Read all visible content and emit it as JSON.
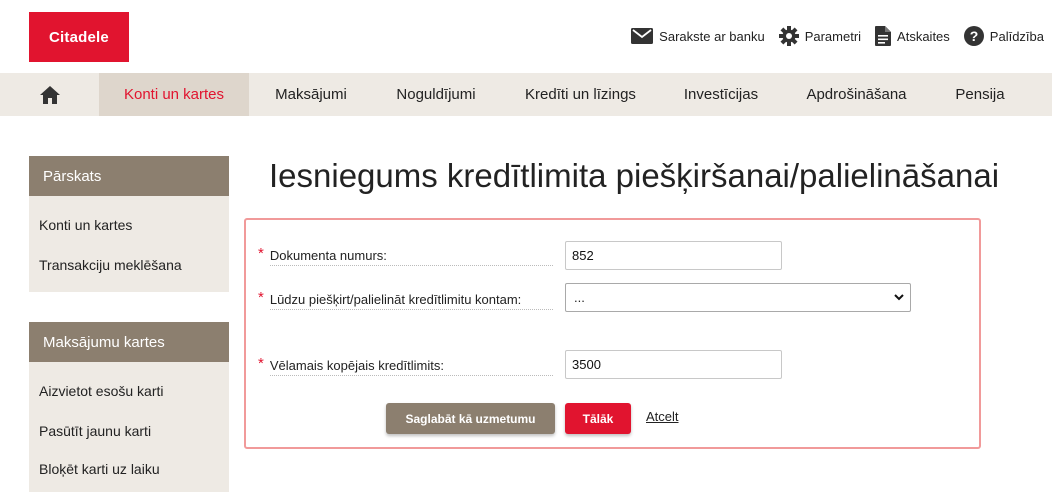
{
  "brand": {
    "logo_text": "Citadele",
    "accent": "#e1142f"
  },
  "top_links": [
    {
      "label": "Sarakste ar banku",
      "icon": "envelope-icon"
    },
    {
      "label": "Parametri",
      "icon": "gear-icon"
    },
    {
      "label": "Atskaites",
      "icon": "document-icon"
    },
    {
      "label": "Palīdzība",
      "icon": "help-icon"
    }
  ],
  "nav": {
    "home_icon": "home-icon",
    "items": [
      {
        "label": "Konti un kartes",
        "active": true
      },
      {
        "label": "Maksājumi"
      },
      {
        "label": "Noguldījumi"
      },
      {
        "label": "Kredīti un līzings"
      },
      {
        "label": "Investīcijas"
      },
      {
        "label": "Apdrošināšana"
      },
      {
        "label": "Pensija"
      }
    ]
  },
  "sidebar": {
    "sections": [
      {
        "title": "Pārskats",
        "items": [
          "Konti un kartes",
          "Transakciju meklēšana"
        ]
      },
      {
        "title": "Maksājumu kartes",
        "items": [
          "Aizvietot esošu karti",
          "Pasūtīt jaunu karti",
          "Bloķēt karti uz laiku"
        ]
      }
    ]
  },
  "page": {
    "title": "Iesniegums kredītlimita piešķiršanai/palielināšanai"
  },
  "form": {
    "required_mark": "*",
    "document_number": {
      "label": "Dokumenta numurs:",
      "value": "852"
    },
    "account": {
      "label": "Lūdzu piešķirt/palielināt kredītlimitu kontam:",
      "selected": "..."
    },
    "desired_limit": {
      "label": "Vēlamais kopējais kredītlimits:",
      "value": "3500"
    },
    "buttons": {
      "save_draft": "Saglabāt kā uzmetumu",
      "next": "Tālāk",
      "cancel": "Atcelt"
    }
  }
}
